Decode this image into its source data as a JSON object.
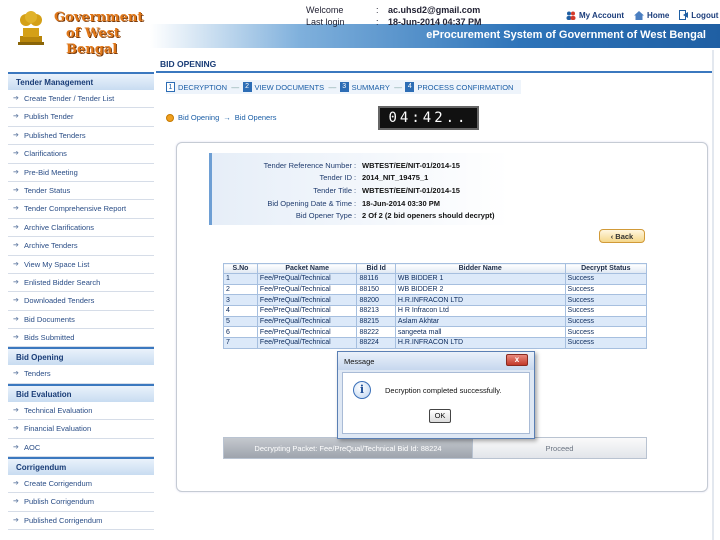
{
  "header": {
    "gov_line1": "Government",
    "gov_line2": "of West Bengal",
    "welcome_label": "Welcome",
    "welcome_value": "ac.uhsd2@gmail.com",
    "lastlogin_label": "Last login",
    "lastlogin_value": "18-Jun-2014 04:37 PM",
    "sep": ":",
    "my_account": "My Account",
    "home": "Home",
    "logout": "Logout",
    "app_title": "eProcurement System of Government of West Bengal"
  },
  "sidebar": {
    "sections": [
      {
        "title": "Tender Management",
        "items": [
          "Create Tender / Tender List",
          "Publish Tender",
          "Published Tenders",
          "Clarifications",
          "Pre-Bid Meeting",
          "Tender Status",
          "Tender Comprehensive Report",
          "Archive Clarifications",
          "Archive Tenders",
          "View My Space List",
          "Enlisted Bidder Search",
          "Downloaded Tenders",
          "Bid Documents",
          "Bids Submitted"
        ]
      },
      {
        "title": "Bid Opening",
        "items": [
          "Tenders"
        ]
      },
      {
        "title": "Bid Evaluation",
        "items": [
          "Technical Evaluation",
          "Financial Evaluation",
          "AOC"
        ]
      },
      {
        "title": "Corrigendum",
        "items": [
          "Create Corrigendum",
          "Publish Corrigendum",
          "Published Corrigendum"
        ]
      }
    ]
  },
  "main": {
    "page_title": "BID OPENING",
    "steps": [
      {
        "num": "1",
        "label": "DECRYPTION"
      },
      {
        "num": "2",
        "label": "VIEW DOCUMENTS"
      },
      {
        "num": "3",
        "label": "SUMMARY"
      },
      {
        "num": "4",
        "label": "PROCESS CONFIRMATION"
      }
    ],
    "breadcrumb": {
      "first": "Bid Opening",
      "sep": "→",
      "second": "Bid Openers"
    },
    "timer": "04:42..",
    "info": [
      {
        "key": "Tender Reference Number",
        "value": "WBTEST/EE/NIT-01/2014-15"
      },
      {
        "key": "Tender ID",
        "value": "2014_NIT_19475_1"
      },
      {
        "key": "Tender Title",
        "value": "WBTEST/EE/NIT-01/2014-15"
      },
      {
        "key": "Bid Opening Date & Time",
        "value": "18-Jun-2014 03:30 PM"
      },
      {
        "key": "Bid Opener Type",
        "value": "2 Of 2 (2 bid openers should decrypt)"
      }
    ],
    "info_sep": ":",
    "back_label": "Back",
    "table": {
      "headers": [
        "S.No",
        "Packet Name",
        "Bid Id",
        "Bidder Name",
        "Decrypt Status"
      ],
      "rows": [
        [
          "1",
          "Fee/PreQual/Technical",
          "88116",
          "WB BIDDER 1",
          "Success"
        ],
        [
          "2",
          "Fee/PreQual/Technical",
          "88150",
          "WB BIDDER 2",
          "Success"
        ],
        [
          "3",
          "Fee/PreQual/Technical",
          "88200",
          "H.R.INFRACON LTD",
          "Success"
        ],
        [
          "4",
          "Fee/PreQual/Technical",
          "88213",
          "H R Infracon Ltd",
          "Success"
        ],
        [
          "5",
          "Fee/PreQual/Technical",
          "88215",
          "Aslam Akhtar",
          "Success"
        ],
        [
          "6",
          "Fee/PreQual/Technical",
          "88222",
          "sangeeta mall",
          "Success"
        ],
        [
          "7",
          "Fee/PreQual/Technical",
          "88224",
          "H.R.INFRACON LTD",
          "Success"
        ]
      ]
    },
    "progress_text": "Decrypting Packet: Fee/PreQual/Technical Bid Id: 88224",
    "proceed_label": "Proceed"
  },
  "dialog": {
    "title": "Message",
    "close": "x",
    "icon": "i",
    "message": "Decryption completed successfully.",
    "ok": "OK"
  }
}
